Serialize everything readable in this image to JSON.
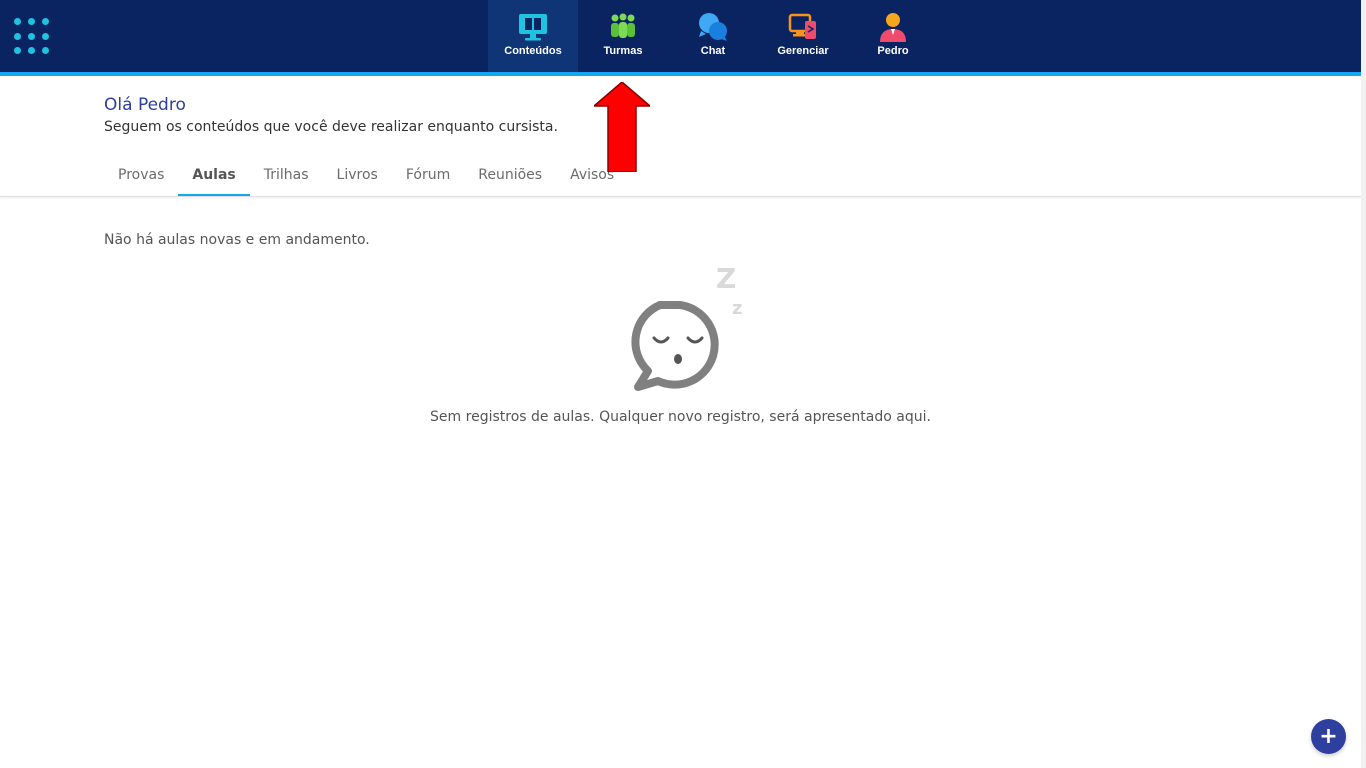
{
  "nav": {
    "items": [
      {
        "label": "Conteúdos",
        "icon": "monitor-book-icon",
        "active": true
      },
      {
        "label": "Turmas",
        "icon": "people-group-icon",
        "active": false
      },
      {
        "label": "Chat",
        "icon": "chat-bubbles-icon",
        "active": false
      },
      {
        "label": "Gerenciar",
        "icon": "manage-devices-icon",
        "active": false
      },
      {
        "label": "Pedro",
        "icon": "user-avatar-icon",
        "active": false
      }
    ]
  },
  "header": {
    "greeting": "Olá",
    "name": "Pedro",
    "subtitle": "Seguem os conteúdos que você deve realizar enquanto cursista."
  },
  "tabs": [
    {
      "label": "Provas",
      "active": false
    },
    {
      "label": "Aulas",
      "active": true
    },
    {
      "label": "Trilhas",
      "active": false
    },
    {
      "label": "Livros",
      "active": false
    },
    {
      "label": "Fórum",
      "active": false
    },
    {
      "label": "Reuniões",
      "active": false
    },
    {
      "label": "Avisos",
      "active": false
    }
  ],
  "content": {
    "empty_note": "Não há aulas novas e em andamento.",
    "empty_message": "Sem registros de aulas. Qualquer novo registro, será apresentado aqui.",
    "illustration_icon": "sleeping-chat-bubble-icon",
    "sleep_letters": [
      "Z",
      "z"
    ]
  },
  "fab": {
    "label": "+",
    "icon": "plus-icon"
  },
  "colors": {
    "topbar": "#0a2462",
    "accent": "#13a8f0",
    "greeting": "#2d3f9a",
    "fab": "#2f3f9e",
    "annotation_arrow": "#ff0000"
  }
}
